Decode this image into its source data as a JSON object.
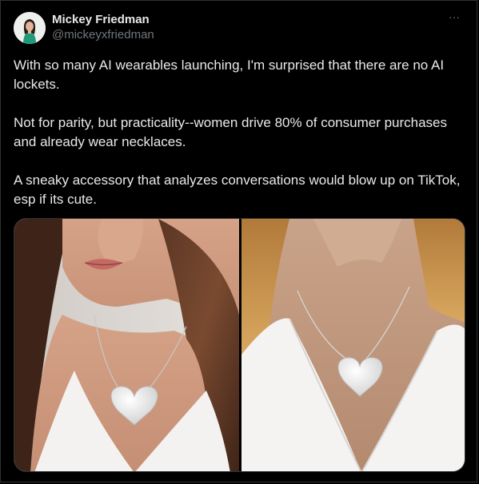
{
  "author": {
    "display_name": "Mickey Friedman",
    "handle": "@mickeyxfriedman",
    "avatar_icon": "profile-photo-avatar"
  },
  "menu": {
    "more_label": "···",
    "icon": "more-options-icon"
  },
  "post": {
    "paragraphs": [
      "With so many AI wearables launching, I'm surprised that there are no AI lockets.",
      "Not for parity, but practicality--women drive 80% of consumer purchases and already wear necklaces.",
      "A sneaky accessory that analyzes conversations would blow up on TikTok, esp if its cute."
    ]
  },
  "media": {
    "count": 2,
    "images": [
      {
        "subject": "woman with long brown hair wearing a white heart locket necklace and white v-neck top"
      },
      {
        "subject": "close-up of white heart locket on silver chain against white v-neck top"
      }
    ]
  },
  "colors": {
    "background": "#000000",
    "text_primary": "#e7e9ea",
    "text_secondary": "#71767b",
    "border": "#2f3336"
  }
}
